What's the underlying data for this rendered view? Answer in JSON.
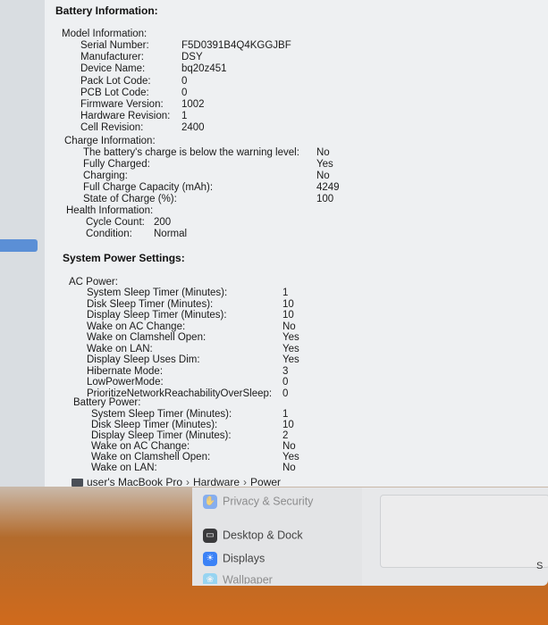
{
  "battery": {
    "title": "Battery Information:",
    "model": {
      "heading": "Model Information:",
      "rows": [
        {
          "label": "Serial Number:",
          "value": "F5D0391B4Q4KGGJBF"
        },
        {
          "label": "Manufacturer:",
          "value": "DSY"
        },
        {
          "label": "Device Name:",
          "value": "bq20z451"
        },
        {
          "label": "Pack Lot Code:",
          "value": "0"
        },
        {
          "label": "PCB Lot Code:",
          "value": "0"
        },
        {
          "label": "Firmware Version:",
          "value": "1002"
        },
        {
          "label": "Hardware Revision:",
          "value": "1"
        },
        {
          "label": "Cell Revision:",
          "value": "2400"
        }
      ]
    },
    "charge": {
      "heading": "Charge Information:",
      "rows": [
        {
          "label": "The battery's charge is below the warning level:",
          "value": "No"
        },
        {
          "label": "Fully Charged:",
          "value": "Yes"
        },
        {
          "label": "Charging:",
          "value": "No"
        },
        {
          "label": "Full Charge Capacity (mAh):",
          "value": "4249"
        },
        {
          "label": "State of Charge (%):",
          "value": "100"
        }
      ]
    },
    "health": {
      "heading": "Health Information:",
      "rows": [
        {
          "label": "Cycle Count:",
          "value": "200"
        },
        {
          "label": "Condition:",
          "value": "Normal"
        }
      ]
    }
  },
  "power": {
    "title": "System Power Settings:",
    "ac": {
      "heading": "AC Power:",
      "rows": [
        {
          "label": "System Sleep Timer (Minutes):",
          "value": "1"
        },
        {
          "label": "Disk Sleep Timer (Minutes):",
          "value": "10"
        },
        {
          "label": "Display Sleep Timer (Minutes):",
          "value": "10"
        },
        {
          "label": "Wake on AC Change:",
          "value": "No"
        },
        {
          "label": "Wake on Clamshell Open:",
          "value": "Yes"
        },
        {
          "label": "Wake on LAN:",
          "value": "Yes"
        },
        {
          "label": "Display Sleep Uses Dim:",
          "value": "Yes"
        },
        {
          "label": "Hibernate Mode:",
          "value": "3"
        },
        {
          "label": "LowPowerMode:",
          "value": "0"
        },
        {
          "label": "PrioritizeNetworkReachabilityOverSleep:",
          "value": "0"
        }
      ]
    },
    "battery_power": {
      "heading": "Battery Power:",
      "rows": [
        {
          "label": "System Sleep Timer (Minutes):",
          "value": "1"
        },
        {
          "label": "Disk Sleep Timer (Minutes):",
          "value": "10"
        },
        {
          "label": "Display Sleep Timer (Minutes):",
          "value": "2"
        },
        {
          "label": "Wake on AC Change:",
          "value": "No"
        },
        {
          "label": "Wake on Clamshell Open:",
          "value": "Yes"
        },
        {
          "label": "Wake on LAN:",
          "value": "No"
        }
      ]
    }
  },
  "breadcrumb": {
    "device": "user's MacBook Pro",
    "sep1": "›",
    "section": "Hardware",
    "sep2": "›",
    "item": "Power"
  },
  "settings_sidebar": {
    "items": [
      {
        "label": "Privacy & Security",
        "icon": "hand-icon",
        "color": "#3b82f6"
      },
      {
        "label": "Desktop & Dock",
        "icon": "dock-icon",
        "color": "#3a3a3c"
      },
      {
        "label": "Displays",
        "icon": "sun-icon",
        "color": "#3b82f6"
      },
      {
        "label": "Wallpaper",
        "icon": "wallpaper-icon",
        "color": "#5ac8fa"
      }
    ]
  },
  "edge_glyph": "S"
}
